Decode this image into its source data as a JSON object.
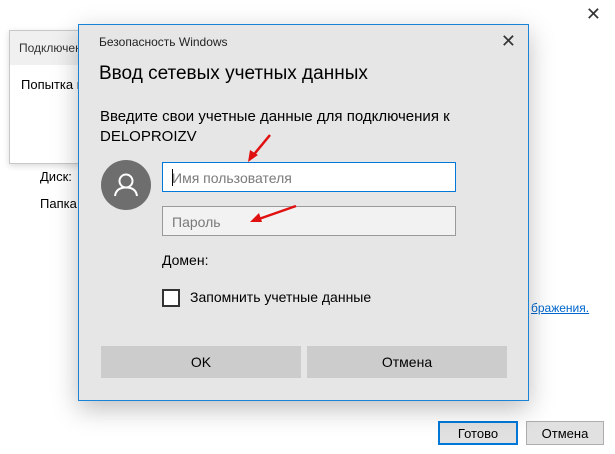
{
  "background_window": {
    "close_glyph": "✕",
    "disk_label": "Диск:",
    "folder_label": "Папка:",
    "link_fragment": "бражения.",
    "done_button": "Готово",
    "cancel_button": "Отмена"
  },
  "mid_dialog": {
    "title": "Подключение сетевого диска",
    "text": "Попытка подключения"
  },
  "dialog": {
    "caption": "Безопасность Windows",
    "close_glyph": "✕",
    "heading": "Ввод сетевых учетных данных",
    "description": "Введите свои учетные данные для подключения к DELOPROIZV",
    "username_placeholder": "Имя пользователя",
    "password_placeholder": "Пароль",
    "domain_label": "Домен:",
    "remember_label": "Запомнить учетные данные",
    "remember_checked": false,
    "ok_button": "OK",
    "cancel_button": "Отмена",
    "avatar_icon": "user-icon"
  },
  "colors": {
    "accent": "#0078d7",
    "arrow": "#e01010",
    "dialog_bg": "#e6e6e6",
    "button_bg": "#cccccc",
    "link": "#0066cc"
  }
}
